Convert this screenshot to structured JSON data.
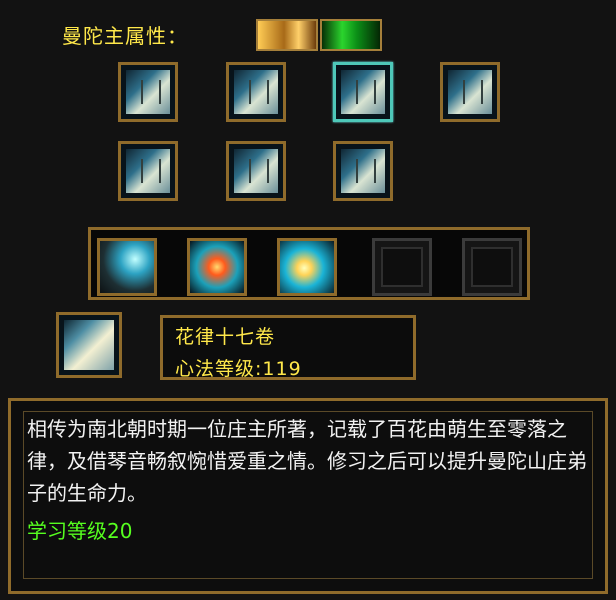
{
  "header": {
    "attribute_label": "曼陀主属性：",
    "attribute_icons": [
      "fire-element-icon",
      "wood-element-icon"
    ],
    "attribute_colors": [
      "#f7c34d",
      "#22c433"
    ]
  },
  "book_grid": {
    "items": [
      {
        "icon": "open-book-icon"
      },
      {
        "icon": "scroll-book-icon"
      },
      {
        "icon": "silk-scroll-icon"
      },
      {
        "icon": "folded-scroll-icon"
      },
      {
        "icon": "blue-book-icon"
      },
      {
        "icon": "stacked-book-icon"
      },
      {
        "icon": "illustrated-book-icon"
      }
    ]
  },
  "skills": {
    "items": [
      {
        "icon": "sword-slash-skill-icon",
        "empty": false
      },
      {
        "icon": "flame-flower-skill-icon",
        "empty": false
      },
      {
        "icon": "lotus-light-skill-icon",
        "empty": false
      },
      {
        "icon": "locked-slot-icon",
        "empty": true
      },
      {
        "icon": "locked-slot-icon",
        "empty": true
      }
    ]
  },
  "selected": {
    "name": "花律十七卷",
    "level": "心法等级:119",
    "icon": "scroll-book-icon"
  },
  "description": {
    "text": "相传为南北朝时期一位庄主所著，记载了百花由萌生至零落之律，及借琴音畅叙惋惜爱重之情。修习之后可以提升曼陀山庄弟子的生命力。",
    "learn_level": "学习等级20"
  }
}
